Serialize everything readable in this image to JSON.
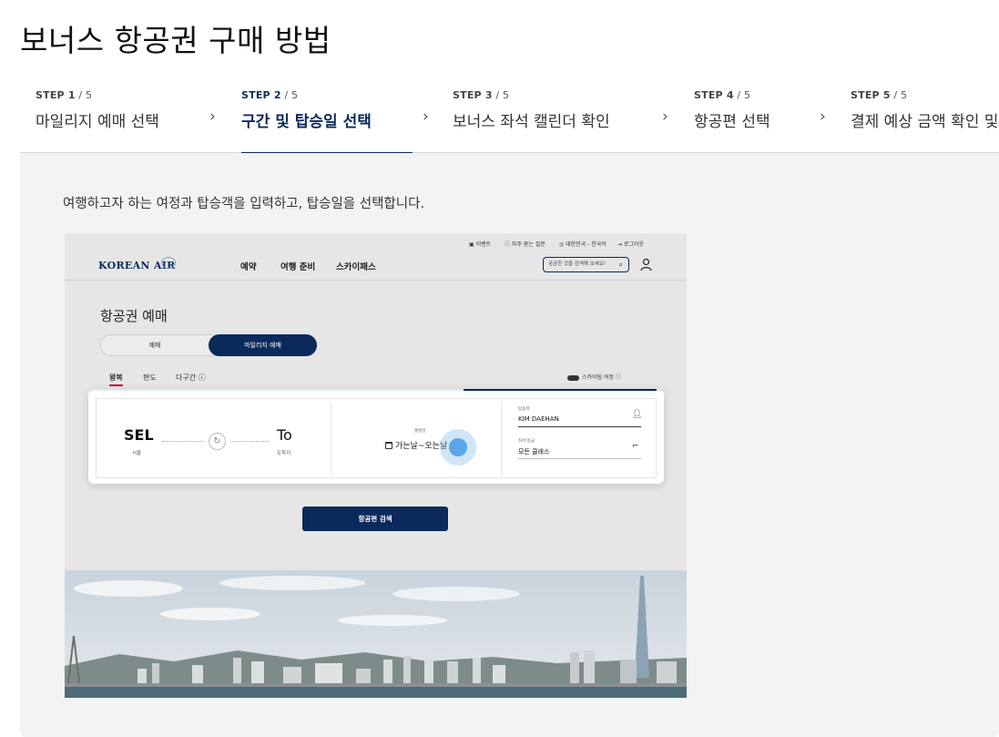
{
  "page": {
    "title": "보너스 항공권 구매 방법"
  },
  "steps": [
    {
      "step": "STEP 1",
      "of": " / 5",
      "label": "마일리지 예매 선택",
      "active": false
    },
    {
      "step": "STEP 2",
      "of": " / 5",
      "label": "구간 및 탑승일 선택",
      "active": true
    },
    {
      "step": "STEP 3",
      "of": " / 5",
      "label": "보너스 좌석 캘린더 확인",
      "active": false
    },
    {
      "step": "STEP 4",
      "of": " / 5",
      "label": "항공편 선택",
      "active": false
    },
    {
      "step": "STEP 5",
      "of": " / 5",
      "label": "결제 예상 금액 확인 및",
      "active": false
    }
  ],
  "panel": {
    "description": "여행하고자 하는 여정과 탑승객을 입력하고, 탑승일을 선택합니다."
  },
  "screenshot": {
    "utility": {
      "event": "이벤트",
      "faq": "자주 묻는 질문",
      "region": "대한민국 - 한국어",
      "logout": "로그아웃"
    },
    "logo": "KOREAN AIR",
    "nav": {
      "booking": "예약",
      "prepare": "여행 준비",
      "skypass": "스카이패스"
    },
    "search_placeholder": "궁금한 것을 검색해 보세요!",
    "booking_title": "항공권 예매",
    "toggle": {
      "normal": "예매",
      "mileage": "마일리지 예매"
    },
    "trip_tabs": {
      "round": "왕복",
      "oneway": "편도",
      "multi": "다구간"
    },
    "skypass_toggle": "스카이팀 여정",
    "from": {
      "code": "SEL",
      "name": "서울"
    },
    "to": {
      "code": "To",
      "name": "도착지"
    },
    "date": {
      "label": "출발일",
      "value": "가는날~오는날"
    },
    "passenger": {
      "label": "탑승객",
      "value": "KIM DAEHAN"
    },
    "cabin": {
      "label": "좌석 등급",
      "value": "모든 클래스"
    },
    "search_button": "항공편 검색"
  },
  "colors": {
    "navy": "#0b2a5b",
    "active_tab_underline": "#c8102e",
    "cursor_highlight": "#5aa6e6"
  }
}
